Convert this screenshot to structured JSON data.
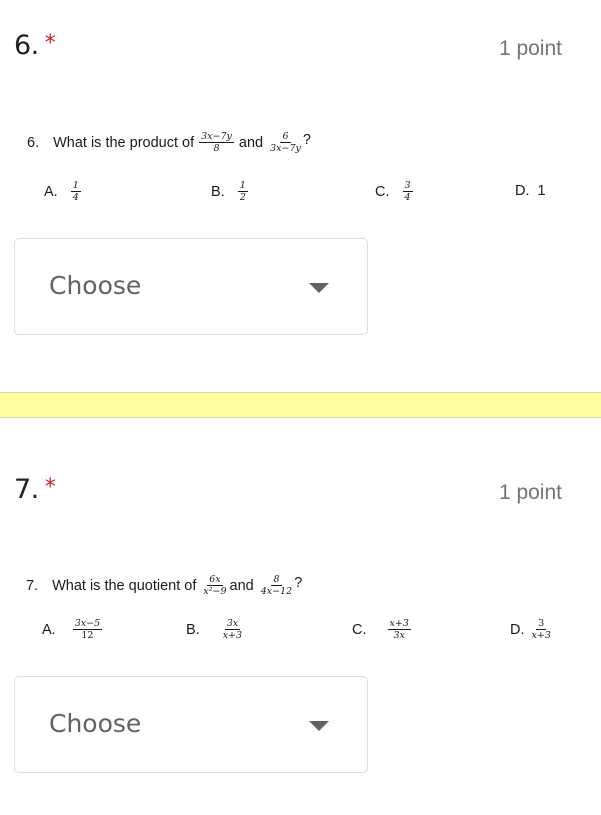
{
  "questions": [
    {
      "number": "6.",
      "required_marker": "*",
      "points": "1 point",
      "image": {
        "stem_number": "6.",
        "stem_text": "What is the product of",
        "frac1": {
          "num": "3x−7y",
          "den": "8"
        },
        "connector": "and",
        "frac2": {
          "num": "6",
          "den": "3x−7y"
        },
        "end": "?",
        "options": [
          {
            "letter": "A.",
            "num": "1",
            "den": "4"
          },
          {
            "letter": "B.",
            "num": "1",
            "den": "2"
          },
          {
            "letter": "C.",
            "num": "3",
            "den": "4"
          },
          {
            "letter": "D.",
            "text": "1"
          }
        ]
      },
      "dropdown": {
        "value": "Choose"
      }
    },
    {
      "number": "7.",
      "required_marker": "*",
      "points": "1 point",
      "image": {
        "stem_number": "7.",
        "stem_text": "What is the quotient of",
        "frac1": {
          "num": "6x",
          "den": "x²−9"
        },
        "connector": "and",
        "frac2": {
          "num": "8",
          "den": "4x−12"
        },
        "end": "?",
        "options": [
          {
            "letter": "A.",
            "num": "3x−5",
            "den": "12"
          },
          {
            "letter": "B.",
            "num": "3x",
            "den": "x+3"
          },
          {
            "letter": "C.",
            "num": "x+3",
            "den": "3x"
          },
          {
            "letter": "D.",
            "num": "3",
            "den": "x+3"
          }
        ]
      },
      "dropdown": {
        "value": "Choose"
      }
    }
  ],
  "colors": {
    "required": "#c5221f",
    "band": "#fdfc9f",
    "points": "#70757a"
  }
}
